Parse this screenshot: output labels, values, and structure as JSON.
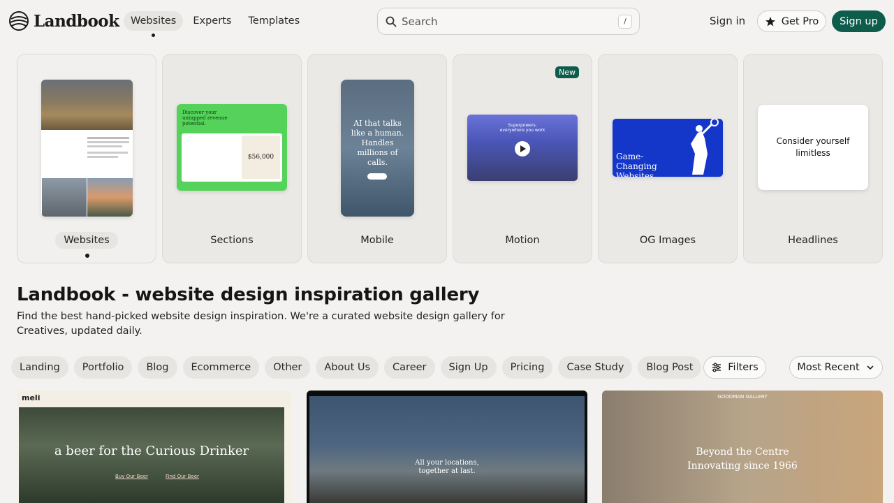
{
  "header": {
    "logo_text": "Landbook",
    "nav": [
      {
        "label": "Websites",
        "active": true
      },
      {
        "label": "Experts"
      },
      {
        "label": "Templates"
      }
    ],
    "search": {
      "placeholder": "Search",
      "shortcut": "/"
    },
    "signin_label": "Sign in",
    "getpro_label": "Get Pro",
    "signup_label": "Sign up"
  },
  "categories": [
    {
      "label": "Websites",
      "active": true
    },
    {
      "label": "Sections"
    },
    {
      "label": "Mobile"
    },
    {
      "label": "Motion",
      "badge": "New"
    },
    {
      "label": "OG Images"
    },
    {
      "label": "Headlines"
    }
  ],
  "previews": {
    "sections_title": "Discover your untapped revenue potential.",
    "sections_amount": "$56,000",
    "mobile_text": "AI that talks like a human. Handles millions of calls.",
    "motion_text": "Superpowers, everywhere you work",
    "og_text": "Game-Changing Websites",
    "headline_text": "Consider yourself limitless"
  },
  "hero": {
    "title": "Landbook - website design inspiration gallery",
    "subtitle": "Find the best hand-picked website design inspiration. We're a curated website design gallery for Creatives, updated daily."
  },
  "filters": {
    "chips": [
      "Landing",
      "Portfolio",
      "Blog",
      "Ecommerce",
      "Other",
      "About Us",
      "Career",
      "Sign Up",
      "Pricing",
      "Case Study",
      "Blog Post"
    ],
    "filters_label": "Filters",
    "sort_label": "Most Recent"
  },
  "gallery": [
    {
      "brand": "meli",
      "headline": "a beer for the Curious Drinker",
      "links": [
        "Buy Our Beer",
        "Find Our Beer"
      ]
    },
    {
      "headline": "All your locations, together at last."
    },
    {
      "brand": "GOODMAN GALLERY",
      "headline": "Beyond the Centre",
      "sub": "Innovating since 1966"
    }
  ],
  "colors": {
    "accent": "#0e5c4c",
    "background": "#f3f2f0",
    "chip": "#e6e5e2"
  }
}
